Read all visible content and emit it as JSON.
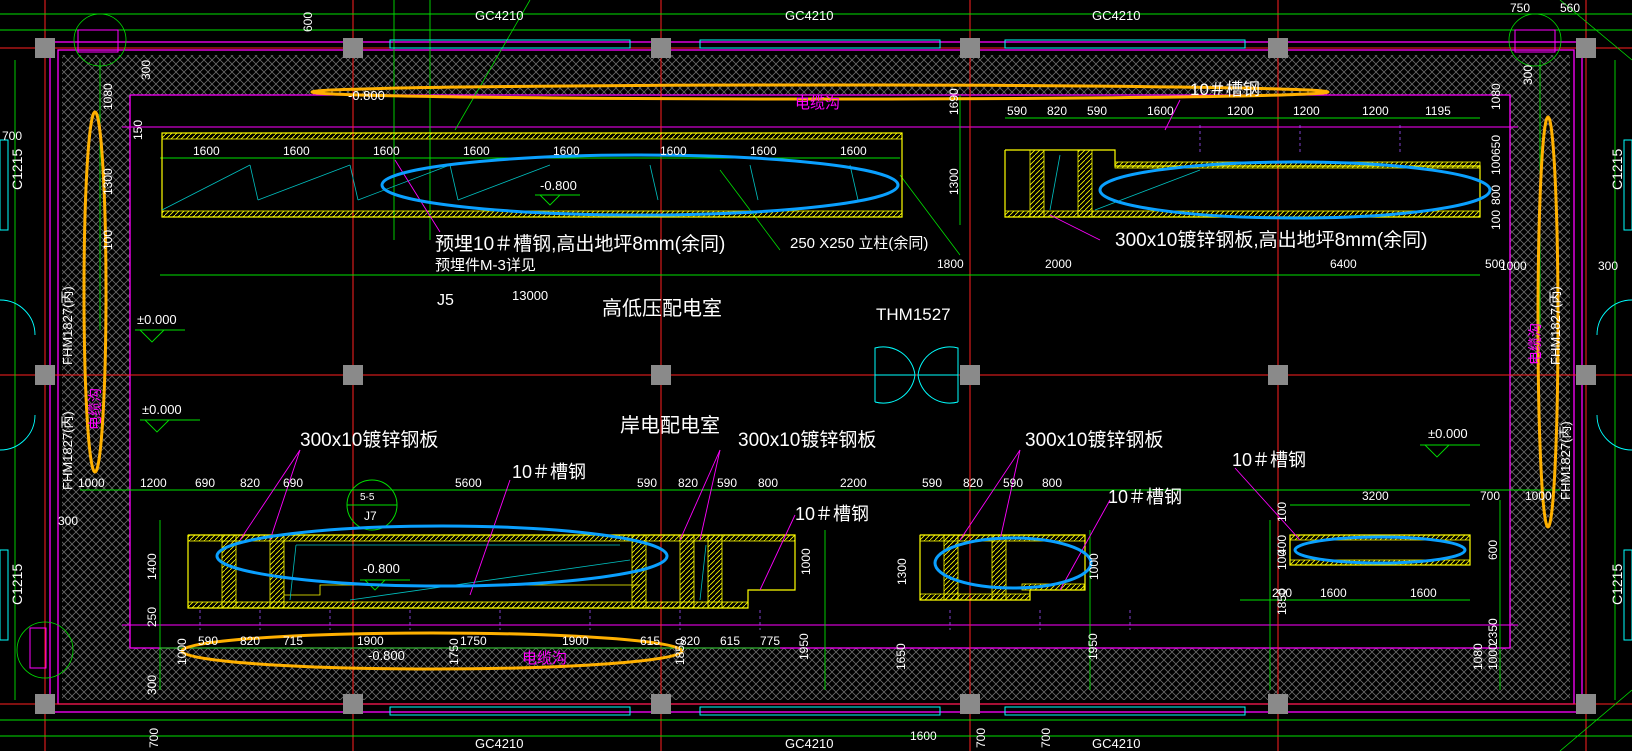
{
  "colors": {
    "background": "#000000",
    "wall": "#ff00ff",
    "axis": "#ff0000",
    "dimension": "#00ff00",
    "trench": "#ffff00",
    "text": "#ffffff",
    "note_leader": "#ff00ff",
    "highlight_blue": "#00a0ff",
    "highlight_orange": "#ffb000",
    "window": "#00ffff",
    "column": "#808080"
  },
  "windows": {
    "top": [
      "GC4210",
      "GC4210",
      "GC4210"
    ],
    "bottom": [
      "GC4210",
      "GC4210",
      "GC4210"
    ],
    "side": [
      "C1215",
      "C1215",
      "C1215",
      "C1215"
    ]
  },
  "doors": {
    "left_upper": "FHM1827(丙)",
    "left_lower": "FHM1827(丙)",
    "right_upper": "FHM1827(丙)",
    "right_lower": "FHM1827(丙)",
    "center": "THM1527"
  },
  "rooms": {
    "upper": "高低压配电室",
    "lower": "岸电配电室",
    "top_trench": "电缆沟",
    "bottom_trench": "电缆沟",
    "left_trench": "电缆沟",
    "right_trench": "电缆沟"
  },
  "labels": {
    "j5": "J5",
    "j7": "J7",
    "detail": "5-5",
    "span13000": "13000"
  },
  "elevations": {
    "left_upper": "±0.000",
    "left_lower": "±0.000",
    "right_lower": "±0.000",
    "top_trench": "-0.800",
    "upper_left_trench": "-0.800",
    "lower_left_trench": "-0.800",
    "bottom_trench": "-0.800"
  },
  "notes": {
    "embed": "预埋10＃槽钢,高出地坪8mm(余同)",
    "embed_detail": "预埋件M-3详见",
    "column": "250  X250  立柱(余同)",
    "plate_high": "300x10镀锌钢板,高出地坪8mm(余同)",
    "channel_top": "10＃槽钢",
    "plate1": "300x10镀锌钢板",
    "plate2": "300x10镀锌钢板",
    "plate3": "300x10镀锌钢板",
    "channel1": "10＃槽钢",
    "channel2": "10＃槽钢",
    "channel3": "10＃槽钢",
    "channel4": "10＃槽钢"
  },
  "dims": {
    "top_right": [
      "750",
      "560"
    ],
    "top_600": "600",
    "left_side": [
      "300",
      "1080",
      "150",
      "700",
      "1300",
      "100"
    ],
    "right_side": [
      "1080",
      "650",
      "100",
      "800",
      "300",
      "100",
      "1000",
      "300"
    ],
    "upper_left_chain": [
      "1600",
      "1600",
      "1600",
      "1600",
      "1600",
      "1600",
      "1600",
      "1600"
    ],
    "upper_right_chain": [
      "590",
      "820",
      "590",
      "1600",
      "1200",
      "1200",
      "1200",
      "1195"
    ],
    "upper_mid": [
      "1690",
      "1300"
    ],
    "lower_chain_full": [
      "1800",
      "2000",
      "6400",
      "500"
    ],
    "lower_left_chain": [
      "1000",
      "1200",
      "690",
      "820",
      "690",
      "5600",
      "590",
      "820",
      "590",
      "800",
      "2200",
      "590",
      "820",
      "590",
      "800",
      "3200",
      "700",
      "1000"
    ],
    "lower_left_side": [
      "300",
      "1400",
      "250",
      "300"
    ],
    "lower_mid_vert": [
      "1000",
      "1300",
      "1000"
    ],
    "lower_right_vert": [
      "100",
      "400",
      "100",
      "1850",
      "600",
      "2350",
      "1000"
    ],
    "lower_right_chain": [
      "200",
      "1600",
      "1600"
    ],
    "bottom_chain": [
      "1000",
      "590",
      "820",
      "715",
      "1900",
      "1750",
      "1900",
      "615",
      "820",
      "615",
      "775"
    ],
    "bottom_vert": [
      "1750",
      "1850",
      "1950",
      "1650",
      "1950",
      "1080"
    ],
    "bottom_row": [
      "700",
      "1600",
      "700",
      "700"
    ]
  }
}
